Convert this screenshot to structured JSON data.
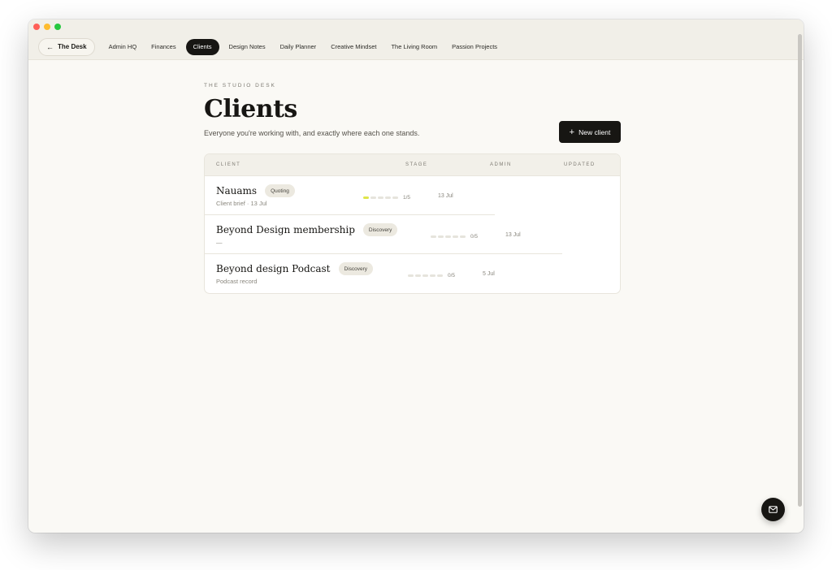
{
  "nav": {
    "back_label": "The Desk",
    "tabs": [
      {
        "label": "Admin HQ"
      },
      {
        "label": "Finances"
      },
      {
        "label": "Clients"
      },
      {
        "label": "Design Notes"
      },
      {
        "label": "Daily Planner"
      },
      {
        "label": "Creative Mindset"
      },
      {
        "label": "The Living Room"
      },
      {
        "label": "Passion Projects"
      }
    ],
    "active_tab": "Clients"
  },
  "header": {
    "eyebrow": "THE STUDIO DESK",
    "title": "Clients",
    "subtitle": "Everyone you're working with, and exactly where each one stands.",
    "new_button_label": "New client"
  },
  "table": {
    "columns": {
      "client": "CLIENT",
      "stage": "STAGE",
      "admin": "ADMIN",
      "updated": "UPDATED"
    },
    "rows": [
      {
        "name": "Nauams",
        "stage_label": "Quoting",
        "meta": "Client brief · 13 Jul",
        "progress": 1,
        "progress_total": 5,
        "progress_text": "1/5",
        "updated": "13 Jul"
      },
      {
        "name": "Beyond Design membership",
        "stage_label": "Discovery",
        "meta": "—",
        "progress": 0,
        "progress_total": 5,
        "progress_text": "0/5",
        "updated": "13 Jul"
      },
      {
        "name": "Beyond design Podcast",
        "stage_label": "Discovery",
        "meta": "Podcast record",
        "progress": 0,
        "progress_total": 5,
        "progress_text": "0/5",
        "updated": "5 Jul"
      }
    ]
  },
  "colors": {
    "accent": "#171613",
    "progress_on": "#dfe54a",
    "background": "#faf9f5"
  },
  "icons": {
    "back": "arrow-left-icon",
    "new": "plus-icon",
    "fab": "mail-icon"
  }
}
